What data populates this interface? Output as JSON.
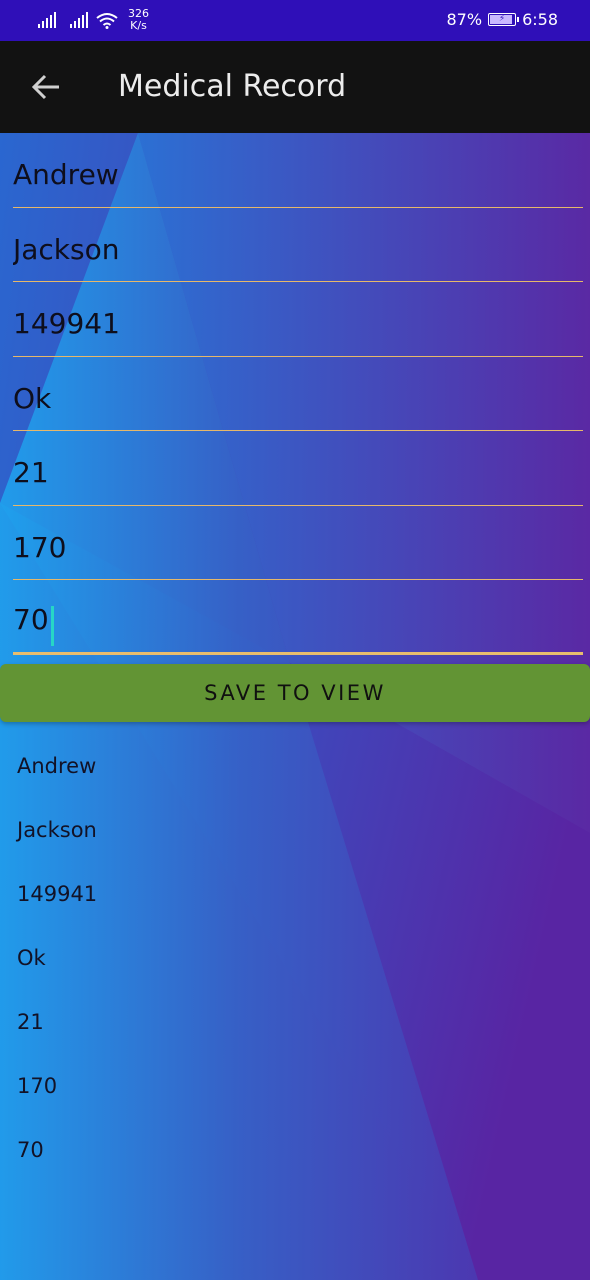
{
  "status_bar": {
    "net_speed_value": "326",
    "net_speed_unit": "K/s",
    "battery_percent": "87%",
    "battery_level": 0.87,
    "time": "6:58",
    "icons": [
      "signal-icon",
      "signal-icon",
      "wifi-icon",
      "battery-icon"
    ]
  },
  "app_bar": {
    "title": "Medical Record",
    "back_icon": "arrow-left-icon"
  },
  "form": {
    "fields": [
      {
        "value": "Andrew"
      },
      {
        "value": "Jackson"
      },
      {
        "value": "149941"
      },
      {
        "value": "Ok"
      },
      {
        "value": "21"
      },
      {
        "value": "170"
      },
      {
        "value": "70"
      }
    ]
  },
  "save_button": {
    "label": "SAVE TO VIEW"
  },
  "output": {
    "items": [
      "Andrew",
      "Jackson",
      "149941",
      "Ok",
      "21",
      "170",
      "70"
    ]
  },
  "colors": {
    "status_bar": "#2f0fb8",
    "app_bar": "#121212",
    "gradient_light": "#1e9be8",
    "gradient_dark": "#5b1fa0",
    "field_underline": "#e6b86a",
    "button": "#629434",
    "cursor": "#27d6c6"
  }
}
